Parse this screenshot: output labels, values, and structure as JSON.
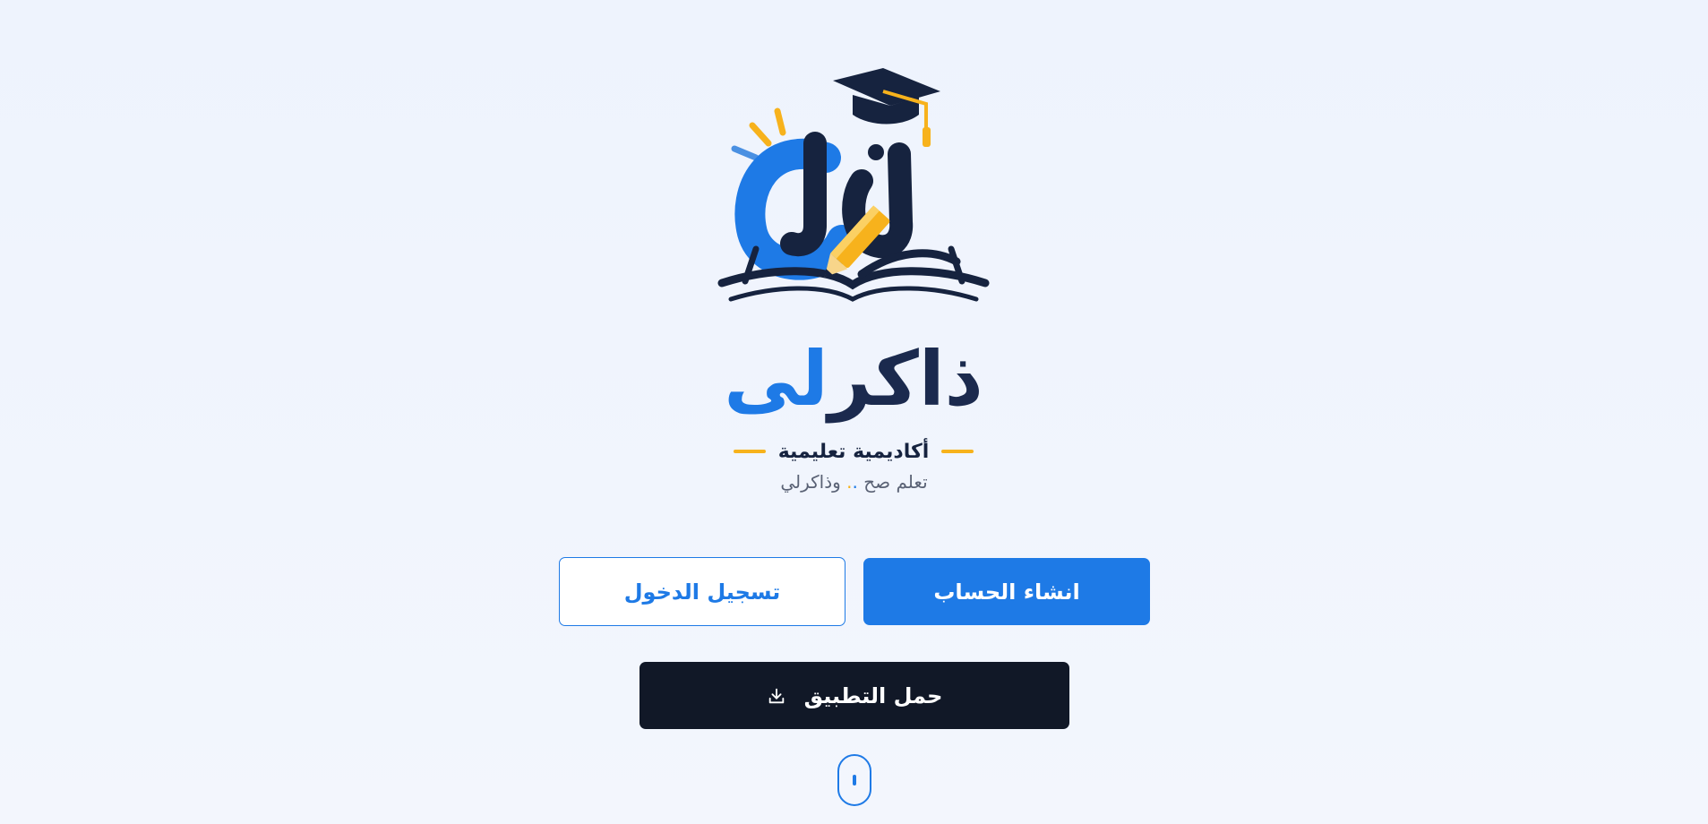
{
  "brand": {
    "logo_icon": "graduation-cap-book-pencil-logo",
    "name_dark": "ذاكر",
    "name_blue": "لى",
    "subtitle": "أكاديمية تعليمية",
    "tagline_start": "تعلم صح",
    "tagline_dot1": ".",
    "tagline_dot2": ".",
    "tagline_end": " وذاكرلي"
  },
  "actions": {
    "signup_label": "انشاء الحساب",
    "login_label": "تسجيل الدخول",
    "download_label": "حمل التطبيق",
    "download_icon": "download-icon"
  },
  "scroll": {
    "icon": "mouse-scroll-icon"
  },
  "colors": {
    "accent_blue": "#1e7ae6",
    "navy": "#16233f",
    "accent_yellow": "#f7b21c",
    "dark_button": "#111827",
    "background": "#eef3fd"
  }
}
